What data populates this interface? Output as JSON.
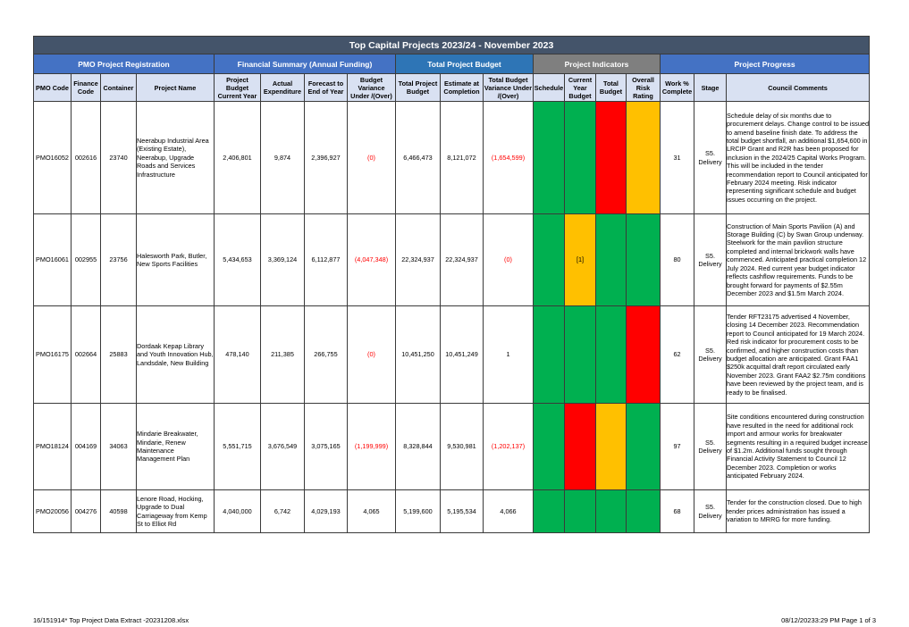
{
  "title": "Top Capital Projects 2023/24 - November 2023",
  "groups": {
    "registration": "PMO Project Registration",
    "financial": "Financial Summary (Annual Funding)",
    "total_budget": "Total Project Budget",
    "indicators": "Project Indicators",
    "progress": "Project Progress"
  },
  "columns": {
    "pmo_code": "PMO Code",
    "finance_code": "Finance Code",
    "container": "Container",
    "project_name": "Project Name",
    "project_budget": "Project Budget Current Year",
    "actual_expenditure": "Actual Expenditure",
    "forecast": "Forecast to End of Year",
    "budget_variance": "Budget Variance Under /(Over)",
    "total_project_budget": "Total Project Budget",
    "estimate_completion": "Estimate at Completion",
    "total_budget_variance": "Total Budget Variance Under /(Over)",
    "schedule": "Schedule",
    "current_year_budget": "Current Year Budget",
    "total_budget": "Total Budget",
    "overall_risk": "Overall Risk Rating",
    "work_complete": "Work % Complete",
    "stage": "Stage",
    "council_comments": "Council Comments"
  },
  "indicator_colors": {
    "green": "#00b050",
    "red": "#ff0000",
    "amber": "#ffc000"
  },
  "rows": [
    {
      "pmo_code": "PMO16052",
      "finance_code": "002616",
      "container": "23740",
      "project_name": "Neerabup Industrial Area (Existing Estate), Neerabup, Upgrade Roads and Services Infrastructure",
      "project_budget": "2,406,801",
      "actual_expenditure": "9,874",
      "forecast": "2,396,927",
      "budget_variance": "(0)",
      "total_project_budget": "6,466,473",
      "estimate_completion": "8,121,072",
      "total_budget_variance": "(1,654,599)",
      "schedule": "green",
      "current_year_budget": "green",
      "total_budget": "red",
      "overall_risk": "amber",
      "indicator_note": "",
      "work_complete": "31",
      "stage": "S5. Delivery",
      "comments": "Schedule delay of six months due to procurement delays. Change control to be issued to amend baseline finish date.  To address the total budget shortfall, an additional $1,654,600 in LRCIP Grant and R2R has been proposed for inclusion in the 2024/25 Capital Works Program. This will be included in the tender recommendation report to Council anticipated for February 2024 meeting. Risk indicator representing significant schedule and budget issues occurring on the project."
    },
    {
      "pmo_code": "PMO16061",
      "finance_code": "002955",
      "container": "23756",
      "project_name": "Halesworth Park, Butler, New Sports Facilities",
      "project_budget": "5,434,653",
      "actual_expenditure": "3,369,124",
      "forecast": "6,112,877",
      "budget_variance": "(4,047,348)",
      "total_project_budget": "22,324,937",
      "estimate_completion": "22,324,937",
      "total_budget_variance": "(0)",
      "schedule": "green",
      "current_year_budget": "amber",
      "total_budget": "green",
      "overall_risk": "green",
      "indicator_note": "[1]",
      "work_complete": "80",
      "stage": "S5. Delivery",
      "comments": "Construction of Main Sports Pavilion (A) and Storage Building (C) by Swan Group underway.  Steelwork for the main pavilion structure completed and internal brickwork walls have commenced.  Anticipated practical completion 12 July 2024. Red current year budget indicator reflects cashflow requirements. Funds to be brought forward for payments of $2.55m December 2023 and $1.5m March 2024."
    },
    {
      "pmo_code": "PMO16175",
      "finance_code": "002664",
      "container": "25883",
      "project_name": "Dordaak Kepap Library and Youth Innovation Hub, Landsdale, New Building",
      "project_budget": "478,140",
      "actual_expenditure": "211,385",
      "forecast": "266,755",
      "budget_variance": "(0)",
      "total_project_budget": "10,451,250",
      "estimate_completion": "10,451,249",
      "total_budget_variance": "1",
      "schedule": "green",
      "current_year_budget": "green",
      "total_budget": "green",
      "overall_risk": "red",
      "indicator_note": "",
      "work_complete": "62",
      "stage": "S5. Delivery",
      "comments": "Tender RFT23175 advertised 4 November, closing 14 December 2023. Recommendation report to Council anticipated for 19 March 2024.  Red risk indicator for procurement costs to be confirmed, and higher construction costs than budget allocation are anticipated. Grant FAA1 $250k acquittal draft report circulated early November 2023.  Grant FAA2 $2.75m conditions have been reviewed by the project team, and is ready to be finalised."
    },
    {
      "pmo_code": "PMO18124",
      "finance_code": "004169",
      "container": "34063",
      "project_name": "Mindarie Breakwater, Mindarie, Renew Maintenance Management Plan",
      "project_budget": "5,551,715",
      "actual_expenditure": "3,676,549",
      "forecast": "3,075,165",
      "budget_variance": "(1,199,999)",
      "total_project_budget": "8,328,844",
      "estimate_completion": "9,530,981",
      "total_budget_variance": "(1,202,137)",
      "schedule": "green",
      "current_year_budget": "red",
      "total_budget": "amber",
      "overall_risk": "green",
      "indicator_note": "",
      "work_complete": "97",
      "stage": "S5. Delivery",
      "comments": "Site conditions encountered during construction have resulted in the need for additional rock import and armour works for breakwater segments resulting in a required budget increase of $1.2m. Additional funds sought through Financial Activity Statement to Council 12 December 2023.  Completion or works anticipated February 2024."
    },
    {
      "pmo_code": "PMO20056",
      "finance_code": "004276",
      "container": "40598",
      "project_name": "Lenore Road, Hocking, Upgrade to Dual Carriageway from Kemp St to Elliot Rd",
      "project_budget": "4,040,000",
      "actual_expenditure": "6,742",
      "forecast": "4,029,193",
      "budget_variance": "4,065",
      "total_project_budget": "5,199,600",
      "estimate_completion": "5,195,534",
      "total_budget_variance": "4,066",
      "schedule": "green",
      "current_year_budget": "green",
      "total_budget": "green",
      "overall_risk": "green",
      "indicator_note": "",
      "work_complete": "68",
      "stage": "S5. Delivery",
      "comments": "Tender for the construction closed.  Due to high tender prices administration has issued a variation to MRRG for more funding."
    }
  ],
  "footer": {
    "left": "16/151914*  Top Project Data Extract -20231208.xlsx",
    "right": "08/12/20233:29 PM    Page 1 of 3"
  }
}
